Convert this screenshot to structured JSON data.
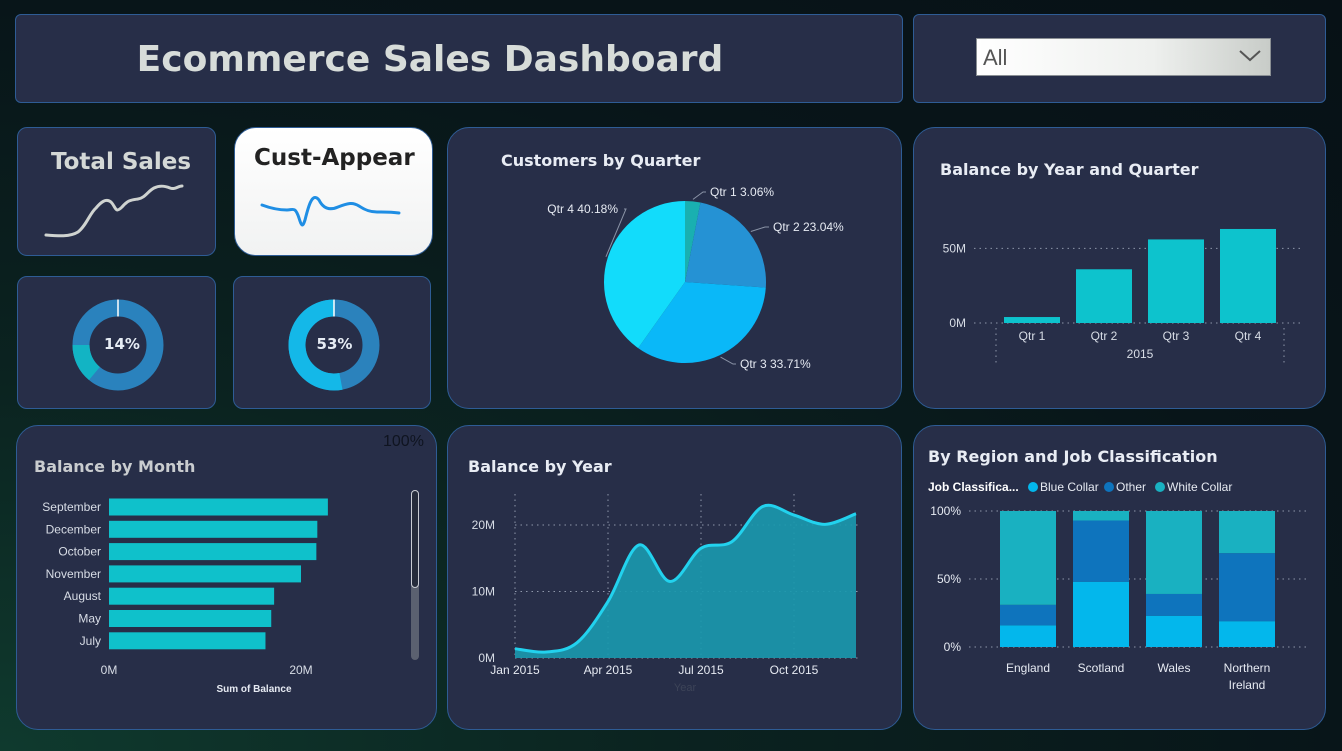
{
  "header": {
    "title": "Ecommerce Sales Dashboard"
  },
  "filter": {
    "selected": "All"
  },
  "kpi": {
    "total_sales": {
      "label": "Total Sales"
    },
    "cust_appear": {
      "label": "Cust-Appear"
    }
  },
  "gauges": [
    {
      "label": "14%",
      "value": 0.14,
      "track_color": "#2a82bd",
      "fill_color": "#12b4c4"
    },
    {
      "label": "53%",
      "value": 0.53,
      "track_color": "#2b82bc",
      "fill_color": "#14b8e8"
    }
  ],
  "colors": {
    "teal": "#0fc1cb",
    "area_line": "#22d2ee",
    "area_fill": "#1a98ae"
  },
  "chart_data": [
    {
      "id": "customers_by_quarter",
      "type": "pie",
      "title": "Customers by Quarter",
      "slices": [
        {
          "label": "Qtr 1",
          "value": 3.06,
          "display": "Qtr 1 3.06%",
          "color": "#19b0b0"
        },
        {
          "label": "Qtr 2",
          "value": 23.04,
          "display": "Qtr 2 23.04%",
          "color": "#2592d4"
        },
        {
          "label": "Qtr 3",
          "value": 33.71,
          "display": "Qtr 3 33.71%",
          "color": "#0ab8f8"
        },
        {
          "label": "Qtr 4",
          "value": 40.18,
          "display": "Qtr 4 40.18%",
          "color": "#12dcfb"
        }
      ]
    },
    {
      "id": "balance_by_year_quarter",
      "type": "bar",
      "title": "Balance by Year and Quarter",
      "categories": [
        "Qtr 1",
        "Qtr 2",
        "Qtr 3",
        "Qtr 4"
      ],
      "values": [
        4,
        36,
        56,
        63
      ],
      "group_label": "2015",
      "y_ticks": [
        {
          "value": 0,
          "label": "0M"
        },
        {
          "value": 50,
          "label": "50M"
        }
      ],
      "ylim": [
        0,
        67
      ],
      "units": "M"
    },
    {
      "id": "balance_by_month",
      "type": "bar",
      "orientation": "horizontal",
      "title": "Balance by Month",
      "categories": [
        "September",
        "December",
        "October",
        "November",
        "August",
        "May",
        "July"
      ],
      "values": [
        22.8,
        21.7,
        21.6,
        20.0,
        17.2,
        16.9,
        16.3
      ],
      "x_ticks": [
        {
          "value": 0,
          "label": "0M"
        },
        {
          "value": 20,
          "label": "20M"
        }
      ],
      "xlim": [
        0,
        32
      ],
      "xlabel": "Sum of Balance",
      "overlay_text": "100%"
    },
    {
      "id": "balance_by_year",
      "type": "area",
      "title": "Balance by Year",
      "xlabel": "Year",
      "x_ticks": [
        {
          "value": 0,
          "label": "Jan 2015"
        },
        {
          "value": 3,
          "label": "Apr 2015"
        },
        {
          "value": 6,
          "label": "Jul 2015"
        },
        {
          "value": 9,
          "label": "Oct 2015"
        }
      ],
      "y_ticks": [
        {
          "value": 0,
          "label": "0M"
        },
        {
          "value": 10,
          "label": "10M"
        },
        {
          "value": 20,
          "label": "20M"
        }
      ],
      "xlim": [
        0,
        11.2
      ],
      "ylim": [
        0,
        24
      ],
      "x": [
        0,
        1,
        2,
        3,
        4,
        5,
        6,
        7,
        8,
        9,
        10,
        11
      ],
      "y": [
        1.4,
        0.9,
        2.3,
        8.5,
        17.0,
        11.5,
        16.5,
        17.5,
        22.8,
        21.5,
        20.1,
        21.7
      ]
    },
    {
      "id": "region_job_classification",
      "type": "bar",
      "stacked": "100%",
      "title": "By Region and Job Classification",
      "legend_title": "Job Classifica...",
      "categories": [
        "England",
        "Scotland",
        "Wales",
        "Northern Ireland"
      ],
      "series": [
        {
          "name": "Blue Collar",
          "values": [
            16,
            48,
            23,
            19
          ],
          "color": "#03b7ec"
        },
        {
          "name": "Other",
          "values": [
            15,
            45,
            16,
            50
          ],
          "color": "#0e74bd"
        },
        {
          "name": "White Collar",
          "values": [
            69,
            7,
            61,
            31
          ],
          "color": "#19b1c1"
        }
      ],
      "y_ticks": [
        {
          "value": 0,
          "label": "0%"
        },
        {
          "value": 50,
          "label": "50%"
        },
        {
          "value": 100,
          "label": "100%"
        }
      ]
    }
  ]
}
